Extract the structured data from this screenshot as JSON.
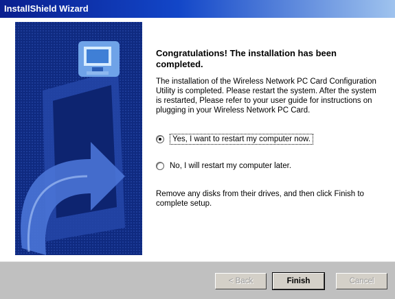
{
  "window": {
    "title": "InstallShield Wizard"
  },
  "main": {
    "heading": "Congratulations! The installation has been completed.",
    "description": "The installation of the Wireless Network PC Card Configuration Utility is completed. Please restart the system. After the system is restarted, Please refer to your user guide for instructions on plugging in your Wireless Network PC Card.",
    "options": [
      {
        "label": "Yes, I want to restart my computer now.",
        "selected": true
      },
      {
        "label": "No, I will restart my computer later.",
        "selected": false
      }
    ],
    "footer_note": "Remove any disks from their drives, and then click Finish to complete setup."
  },
  "buttons": {
    "back": "< Back",
    "finish": "Finish",
    "cancel": "Cancel"
  },
  "colors": {
    "title_bar": "#0a1f8f",
    "side_panel": "#0f2a80"
  }
}
